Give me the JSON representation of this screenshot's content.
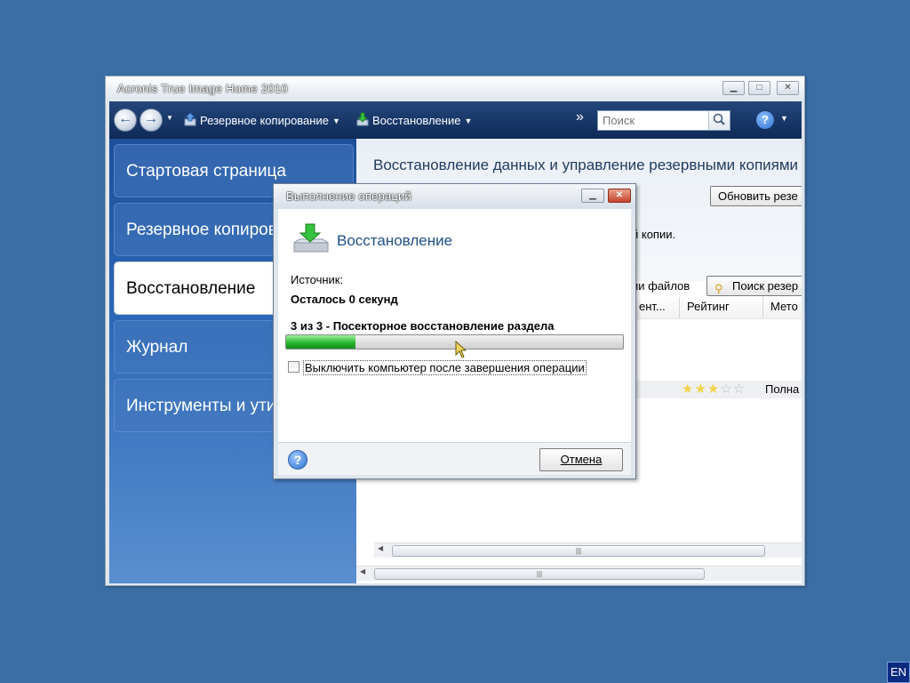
{
  "window": {
    "title": "Acronis True Image Home 2010"
  },
  "toolbar": {
    "backup_label": "Резервное копирование",
    "restore_label": "Восстановление",
    "more_glyph": "»",
    "search_placeholder": "Поиск",
    "help_glyph": "?"
  },
  "sidebar": {
    "items": [
      {
        "label": "Стартовая страница"
      },
      {
        "label": "Резервное копирова"
      },
      {
        "label": "Восстановление"
      },
      {
        "label": "Журнал"
      },
      {
        "label": "Инструменты и утил"
      }
    ]
  },
  "content": {
    "title": "Восстановление данных и управление резервными копиями",
    "refresh_button": "Обновить резе",
    "copies_text": "й копии.",
    "files_text": "ии файлов",
    "search_button": "Поиск резер",
    "columns": [
      "ент...",
      "Рейтинг",
      "Мето"
    ],
    "row_rating_stars": 3,
    "row_rating_max": 5,
    "row_method": "Полна"
  },
  "dialog": {
    "title": "Выполнение операций",
    "heading": "Восстановление",
    "source_label": "Источник:",
    "time_remaining": "Осталось 0 секунд",
    "step_text": "3 из 3 - Посекторное восстановление раздела",
    "progress_fraction": 0.205,
    "shutdown_checkbox_label": "Выключить компьютер после завершения операции",
    "shutdown_checked": false,
    "cancel_button": "Отмена"
  },
  "taskbar": {
    "language": "EN"
  },
  "colors": {
    "desktop": "#3a6ea5",
    "toolbar": "#1a3a6e",
    "sidebar": "#2c68b7",
    "progress": "#22b22b"
  }
}
